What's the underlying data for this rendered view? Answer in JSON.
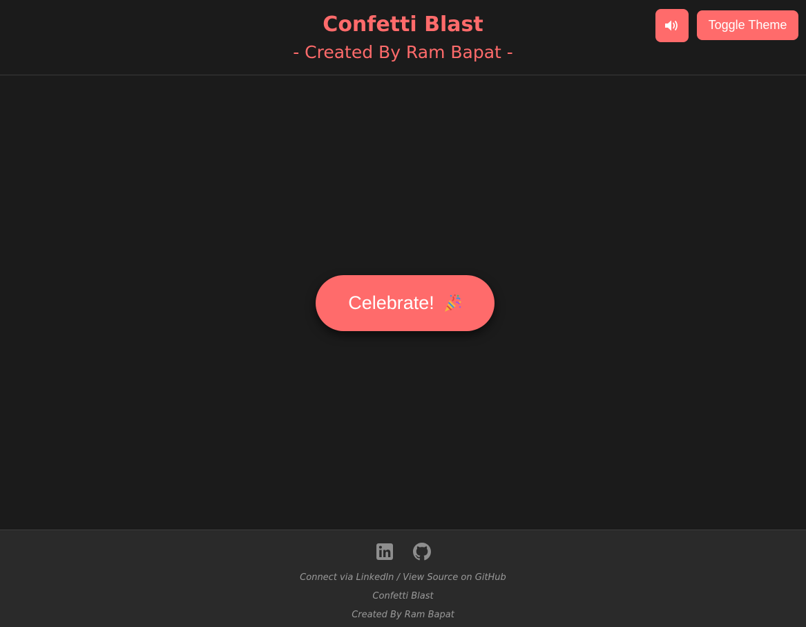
{
  "header": {
    "title": "Confetti Blast",
    "subtitle": "- Created By Ram Bapat -",
    "sound_icon": "speaker-volume-icon",
    "theme_button_label": "Toggle Theme"
  },
  "main": {
    "celebrate_label": "Celebrate!",
    "celebrate_icon": "party-popper-icon"
  },
  "footer": {
    "social_icons": [
      "linkedin-icon",
      "github-icon"
    ],
    "connect_text": "Connect via",
    "linkedin_label": "LinkedIn",
    "separator": "/",
    "github_label": "View Source on GitHub",
    "app_name": "Confetti Blast",
    "credit": "Created By Ram Bapat"
  },
  "colors": {
    "accent": "#ff6b6b",
    "background": "#1b1b1b",
    "footer_background": "#2a2a2a",
    "footer_text": "#9a9a9a"
  }
}
